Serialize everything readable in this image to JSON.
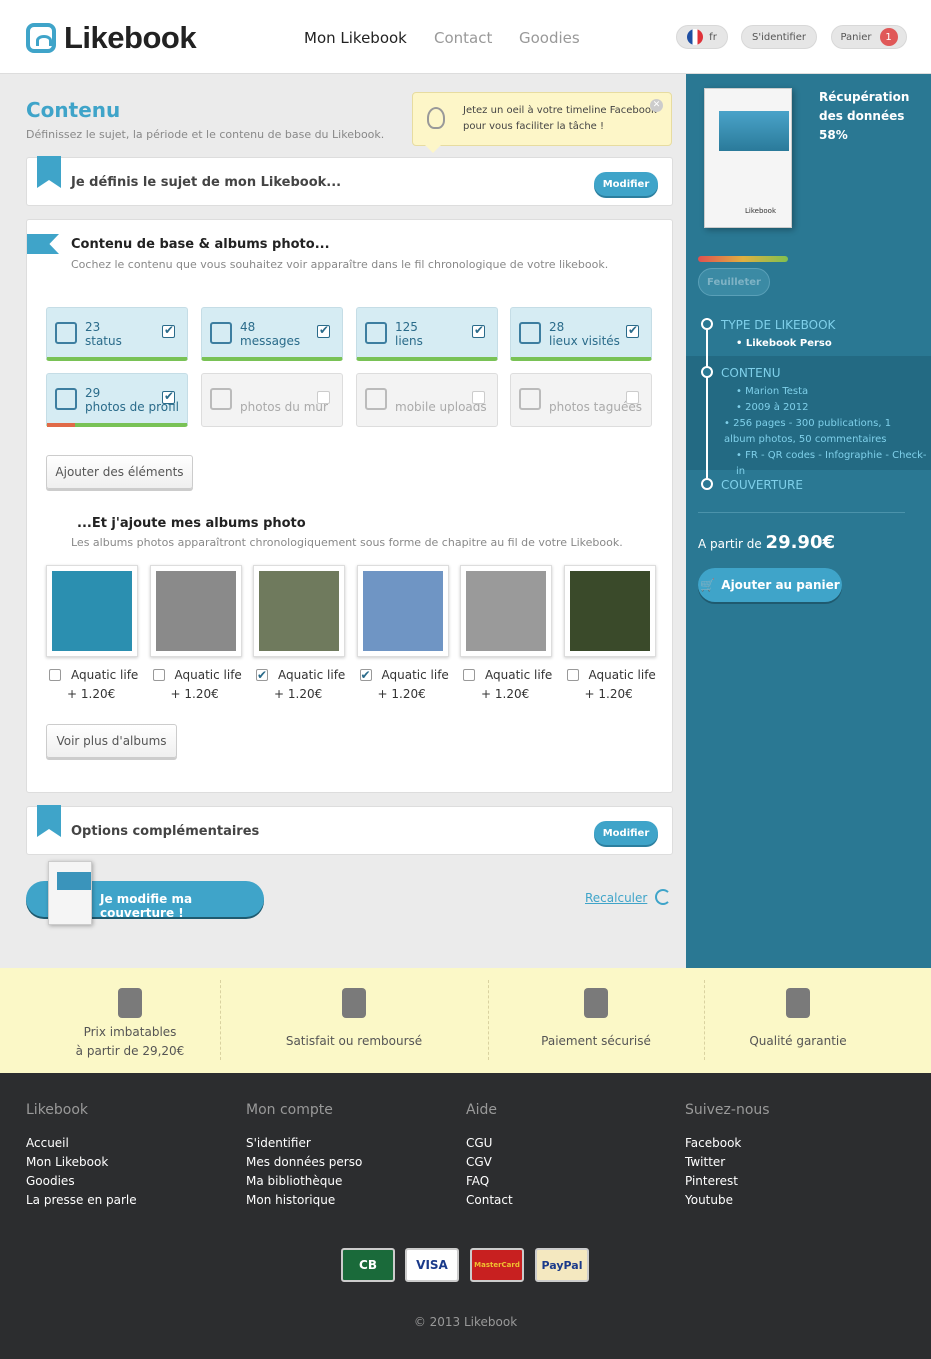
{
  "header": {
    "logo": "Likebook",
    "nav": [
      "Mon Likebook",
      "Contact",
      "Goodies"
    ],
    "lang": "fr",
    "login": "S'identifier",
    "cart": "Panier",
    "cart_count": "1"
  },
  "main": {
    "title": "Contenu",
    "subtitle": "Définissez le sujet, la période et le contenu de base du Likebook.",
    "tip": "Jetez un oeil à votre timeline Facebook pour vous faciliter la tâche !",
    "tip_close": "✕",
    "section1": {
      "title": "Je définis le sujet de mon Likebook...",
      "button": "Modifier"
    },
    "section2": {
      "title": "Contenu de base & albums photo...",
      "desc": "Cochez le contenu que vous souhaitez voir apparaître dans le fil chronologique de votre likebook.",
      "tiles": [
        {
          "count": "23",
          "label": "status",
          "checked": true,
          "icon": "status-icon"
        },
        {
          "count": "48",
          "label": "messages",
          "checked": true,
          "icon": "pencil-icon"
        },
        {
          "count": "125",
          "label": "liens",
          "checked": true,
          "icon": "link-icon"
        },
        {
          "count": "28",
          "label": "lieux visités",
          "checked": true,
          "icon": "flag-icon"
        },
        {
          "count": "29",
          "label": "photos de profil",
          "checked": true,
          "icon": "photo-icon"
        },
        {
          "count": "",
          "label": "photos du mur",
          "checked": false,
          "icon": "photos-icon"
        },
        {
          "count": "",
          "label": "mobile uploads",
          "checked": false,
          "icon": "mobile-icon"
        },
        {
          "count": "",
          "label": "photos taguées",
          "checked": false,
          "icon": "pin-icon"
        }
      ],
      "add_button": "Ajouter des éléments",
      "albums_title": "...Et j'ajoute mes albums photo",
      "albums_desc": "Les albums photos apparaîtront chronologiquement sous forme de chapitre au fil de votre Likebook.",
      "albums": [
        {
          "name": "Aquatic life",
          "price": "+ 1.20€",
          "checked": false,
          "color": "#2b8fb0"
        },
        {
          "name": "Aquatic life",
          "price": "+ 1.20€",
          "checked": false,
          "color": "#8a8a8a"
        },
        {
          "name": "Aquatic life",
          "price": "+ 1.20€",
          "checked": true,
          "color": "#6f7a5d"
        },
        {
          "name": "Aquatic life",
          "price": "+ 1.20€",
          "checked": true,
          "color": "#6f95c4"
        },
        {
          "name": "Aquatic life",
          "price": "+ 1.20€",
          "checked": false,
          "color": "#9a9a9a"
        },
        {
          "name": "Aquatic life",
          "price": "+ 1.20€",
          "checked": false,
          "color": "#3a4a2a"
        }
      ],
      "more_button": "Voir plus d'albums"
    },
    "section3": {
      "title": "Options complémentaires",
      "button": "Modifier"
    },
    "cover_button": "Je modifie ma couverture !",
    "recalc": "Recalculer"
  },
  "sidebar": {
    "book_brand": "Likebook",
    "recup": "Récupération des données 58%",
    "recup_lines": [
      "Récupération",
      "des données",
      "58%"
    ],
    "progress": 0.58,
    "feuilleter": "Feuilleter",
    "type_title": "TYPE DE LIKEBOOK",
    "type_item": "Likebook Perso",
    "contenu_title": "CONTENU",
    "contenu_items": [
      "Marion Testa",
      "2009 à 2012",
      "256 pages - 300 publications, 1 album photos, 50 commentaires",
      "FR - QR codes - Infographie - Check-in"
    ],
    "couverture_title": "COUVERTURE",
    "price_prefix": "A partir de",
    "price": "29.90€",
    "add_to_cart": "Ajouter au panier"
  },
  "features": [
    {
      "label": "Prix imbatables",
      "sub": "à partir de 29,20€",
      "icon": "thumb-icon"
    },
    {
      "label": "Satisfait ou remboursé",
      "sub": "",
      "icon": "calculator-icon"
    },
    {
      "label": "Paiement sécurisé",
      "sub": "",
      "icon": "lock-icon"
    },
    {
      "label": "Qualité garantie",
      "sub": "",
      "icon": "award-icon"
    }
  ],
  "footer": {
    "columns": [
      {
        "title": "Likebook",
        "links": [
          "Accueil",
          "Mon Likebook",
          "Goodies",
          "La presse en parle"
        ]
      },
      {
        "title": "Mon compte",
        "links": [
          "S'identifier",
          "Mes données perso",
          "Ma bibliothèque",
          "Mon historique"
        ]
      },
      {
        "title": "Aide",
        "links": [
          "CGU",
          "CGV",
          "FAQ",
          "Contact"
        ]
      },
      {
        "title": "Suivez-nous",
        "links": [
          "Facebook",
          "Twitter",
          "Pinterest",
          "Youtube"
        ]
      }
    ],
    "cards": [
      "CB",
      "VISA",
      "MasterCard",
      "PayPal"
    ],
    "copyright": "© 2013 Likebook"
  }
}
